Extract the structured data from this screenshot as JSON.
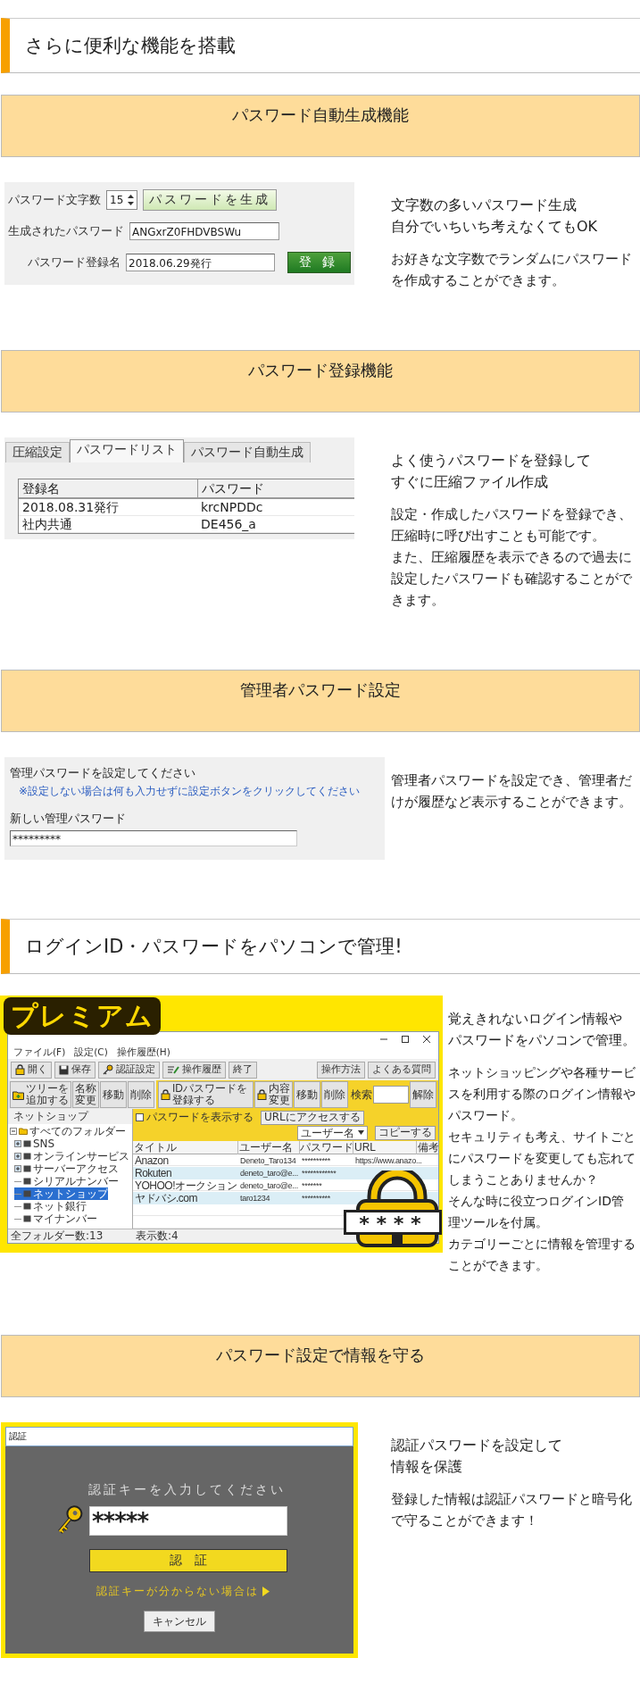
{
  "blocks": [
    {
      "kind": "heading",
      "title": "さらに便利な機能を搭載"
    },
    {
      "kind": "feature",
      "banner": "パスワード自動生成機能",
      "figure": {
        "kind": "generator",
        "length_label": "パスワード文字数",
        "length_value": "15",
        "generate_button": "パスワードを生成",
        "generated_label": "生成されたパスワード",
        "generated_value": "ANGxrZ0FHDVBSWu",
        "name_label": "パスワード登録名",
        "name_value": "2018.06.29発行",
        "register_button": "登 録"
      },
      "heading_lines": [
        "文字数の多いパスワード生成",
        "自分でいちいち考えなくてもOK"
      ],
      "paragraphs": [
        "お好きな文字数でランダムにパスワードを作成することができます。"
      ]
    },
    {
      "kind": "feature",
      "banner": "パスワード登録機能",
      "figure": {
        "kind": "list",
        "tabs": [
          {
            "label": "圧縮設定",
            "selected": false
          },
          {
            "label": "パスワードリスト",
            "selected": true
          },
          {
            "label": "パスワード自動生成",
            "selected": false
          }
        ],
        "columns": [
          "登録名",
          "パスワード"
        ],
        "rows": [
          [
            "2018.08.31発行",
            "krcNPDDc"
          ],
          [
            "社内共通",
            "DE456_a"
          ]
        ]
      },
      "heading_lines": [
        "よく使うパスワードを登録して",
        "すぐに圧縮ファイル作成"
      ],
      "paragraphs": [
        "設定・作成したパスワードを登録でき、圧縮時に呼び出すことも可能です。",
        "また、圧縮履歴を表示できるので過去に設定したパスワードも確認することができます。"
      ]
    },
    {
      "kind": "feature",
      "banner": "管理者パスワード設定",
      "figure": {
        "kind": "admin",
        "prompt": "管理パスワードを設定してください",
        "note": "※設定しない場合は何も入力せずに設定ボタンをクリックしてください",
        "field_label": "新しい管理パスワード",
        "field_value": "*********"
      },
      "paragraphs": [
        "管理者パスワードを設定でき、管理者だけが履歴など表示することができます。"
      ]
    },
    {
      "kind": "heading",
      "title": "ログインID・パスワードをパソコンで管理!"
    },
    {
      "kind": "feature",
      "figure": {
        "kind": "manager",
        "logo": "プレミアム",
        "menu": [
          "ファイル(F)",
          "設定(C)",
          "操作履歴(H)"
        ],
        "toolbar": [
          "開く",
          "保存",
          "認証設定",
          "操作履歴",
          "終了"
        ],
        "help_buttons": [
          "操作方法",
          "よくある質問"
        ],
        "tree_buttons": [
          "ツリーを追加する",
          "名称変更",
          "移動",
          "削除"
        ],
        "entry_buttons": [
          "IDパスワードを登録する",
          "内容変更",
          "移動",
          "削除"
        ],
        "search_label": "検索",
        "clear_button": "解除",
        "folder_title": "ネットショップ",
        "show_password": {
          "label": "パスワードを表示する",
          "checked": false
        },
        "url_button": "URLにアクセスする",
        "copy_select": "ユーザー名",
        "copy_button": "コピーする",
        "tree": {
          "label": "すべてのフォルダー",
          "expanded": true,
          "selected": false,
          "children": [
            {
              "label": "SNS",
              "expanded": false,
              "selected": false
            },
            {
              "label": "オンラインサービス",
              "expanded": false,
              "selected": false
            },
            {
              "label": "サーバーアクセス",
              "expanded": false,
              "selected": false
            },
            {
              "label": "シリアルナンバー",
              "selected": false
            },
            {
              "label": "ネットショップ",
              "selected": true
            },
            {
              "label": "ネット銀行",
              "selected": false
            },
            {
              "label": "マイナンバー",
              "selected": false
            }
          ]
        },
        "columns": [
          "タイトル",
          "ユーザー名",
          "パスワード",
          "URL",
          "備考"
        ],
        "rows": [
          {
            "title": "Anazon",
            "user": "Deneto_Taro134",
            "password": "**********",
            "url": "https://www.anazo..."
          },
          {
            "title": "Rokuten",
            "user": "deneto_taro@e...",
            "password": "************"
          },
          {
            "title": "YOHOO!オークション",
            "user": "deneto_taro@e...",
            "password": "*******"
          },
          {
            "title": "ヤドバシ.com",
            "user": "taro1234",
            "password": "**********"
          }
        ],
        "folder_count": "全フォルダー数:13",
        "shown_count": "表示数:4",
        "lock_code": "****"
      },
      "heading_lines": [
        "覚えきれないログイン情報や",
        "パスワードをパソコンで管理。"
      ],
      "paragraphs": [
        "ネットショッピングや各種サービスを利用する際のログイン情報やパスワード。",
        "セキュリティも考え、サイトごとにパスワードを変更しても忘れてしまうことありませんか？",
        "そんな時に役立つログインID管理ツールを付属。",
        "カテゴリーごとに情報を管理することができます。"
      ]
    },
    {
      "kind": "feature",
      "banner": "パスワード設定で情報を守る",
      "figure": {
        "kind": "auth",
        "window_title": "認証",
        "prompt": "認証キーを入力してください",
        "key_value": "*****",
        "submit_button": "認　証",
        "help_link": "認証キーが分からない場合は",
        "cancel_button": "キャンセル"
      },
      "heading_lines": [
        "認証パスワードを設定して",
        "情報を保護"
      ],
      "paragraphs": [
        "登録した情報は認証パスワードと暗号化で守ることができます！"
      ]
    }
  ]
}
